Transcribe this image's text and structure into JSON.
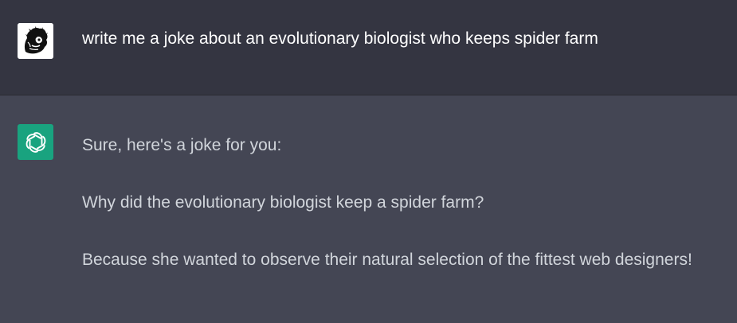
{
  "conversation": {
    "user_message": "write me a joke about an evolutionary biologist who keeps spider farm",
    "assistant_message": {
      "paragraphs": [
        "Sure, here's a joke for you:",
        "Why did the evolutionary biologist keep a spider farm?",
        "Because she wanted to observe their natural selection of the fittest web designers!"
      ]
    }
  },
  "icons": {
    "user_avatar": "lion-head-avatar-icon",
    "assistant_avatar": "openai-logo-icon"
  },
  "colors": {
    "user_row_bg": "#343541",
    "assistant_row_bg": "#444654",
    "assistant_avatar_bg": "#19a37f"
  }
}
